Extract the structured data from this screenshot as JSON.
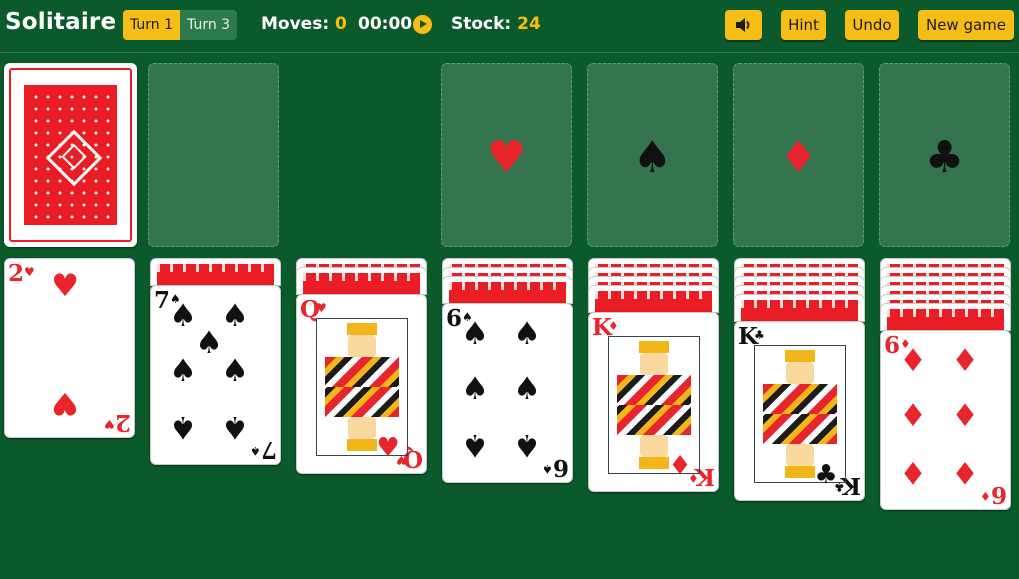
{
  "header": {
    "title": "Solitaire",
    "turn_options": [
      "Turn 1",
      "Turn 3"
    ],
    "turn_selected": "Turn 1",
    "moves_label": "Moves:",
    "moves_value": "0",
    "time_value": "00:00",
    "stock_label": "Stock:",
    "stock_value": "24",
    "hint_label": "Hint",
    "undo_label": "Undo",
    "new_game_label": "New game"
  },
  "colors": {
    "table": "#0b5a2c",
    "accent": "#f6bd16",
    "red_suit": "#e8242c",
    "card_back": "#ea1c24"
  },
  "foundations": [
    {
      "suit": "hearts",
      "symbol": "♥",
      "color": "red"
    },
    {
      "suit": "spades",
      "symbol": "♠",
      "color": "black"
    },
    {
      "suit": "diamonds",
      "symbol": "♦",
      "color": "red"
    },
    {
      "suit": "clubs",
      "symbol": "♣",
      "color": "black"
    }
  ],
  "tableau": [
    {
      "hidden": 0,
      "rank": "2",
      "suit": "♥",
      "color": "red"
    },
    {
      "hidden": 1,
      "rank": "7",
      "suit": "♠",
      "color": "black"
    },
    {
      "hidden": 2,
      "rank": "Q",
      "suit": "♥",
      "color": "red"
    },
    {
      "hidden": 3,
      "rank": "6",
      "suit": "♠",
      "color": "black"
    },
    {
      "hidden": 4,
      "rank": "K",
      "suit": "♦",
      "color": "red"
    },
    {
      "hidden": 5,
      "rank": "K",
      "suit": "♣",
      "color": "black"
    },
    {
      "hidden": 6,
      "rank": "6",
      "suit": "♦",
      "color": "red"
    }
  ],
  "icons": {
    "sound": "speaker-icon",
    "play": "play-icon"
  }
}
